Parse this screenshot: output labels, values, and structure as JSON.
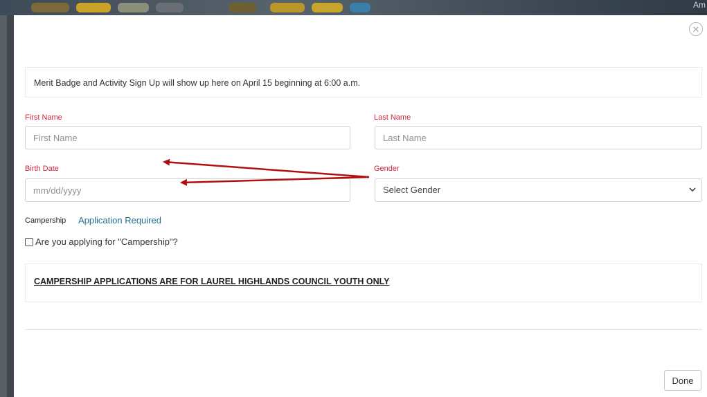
{
  "background": {
    "corner_text": "Am"
  },
  "modal": {
    "close_glyph": "✕",
    "notice": "Merit Badge and Activity Sign Up will show up here on April 15 beginning at 6:00 a.m.",
    "first_name": {
      "label": "First Name",
      "placeholder": "First Name",
      "value": ""
    },
    "last_name": {
      "label": "Last Name",
      "placeholder": "Last Name",
      "value": ""
    },
    "birth_date": {
      "label": "Birth Date",
      "placeholder": "mm/dd/yyyy",
      "value": ""
    },
    "gender": {
      "label": "Gender",
      "selected": "Select Gender",
      "chevron": "▼"
    },
    "campership": {
      "label": "Campership",
      "link_text": "Application Required",
      "checkbox_label": "Are you applying for \"Campership\"?",
      "checked": false
    },
    "warning": "CAMPERSHIP APPLICATIONS ARE FOR LAUREL HIGHLANDS COUNCIL YOUTH ONLY",
    "done_label": "Done"
  },
  "colors": {
    "label_red": "#d0243a",
    "link_teal": "#1f6f8b",
    "annotation_arrow": "#b01010"
  },
  "annotations": {
    "arrows": [
      {
        "from": "gender-label",
        "to": "first-name-field"
      },
      {
        "from": "gender-label",
        "to": "birth-date-field"
      }
    ]
  }
}
